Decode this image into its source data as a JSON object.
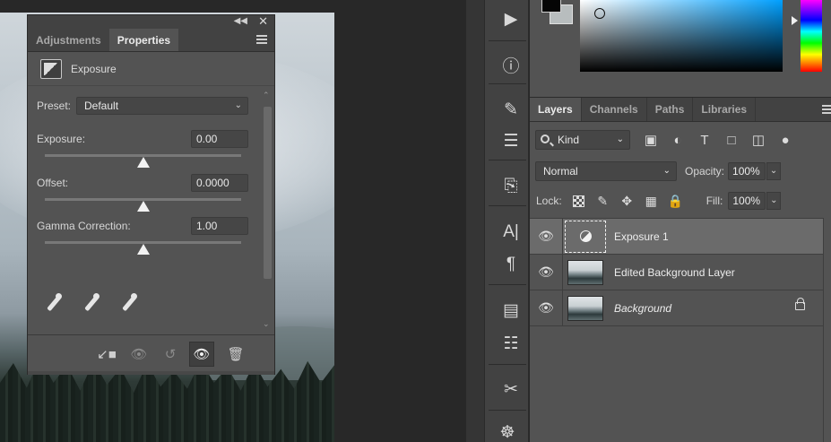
{
  "properties_panel": {
    "tabs": [
      {
        "label": "Adjustments",
        "active": false
      },
      {
        "label": "Properties",
        "active": true
      }
    ],
    "adjustment_title": "Exposure",
    "preset": {
      "label": "Preset:",
      "value": "Default"
    },
    "sliders": [
      {
        "label": "Exposure:",
        "value": "0.00",
        "position": 0.5
      },
      {
        "label": "Offset:",
        "value": "0.0000",
        "position": 0.5
      },
      {
        "label": "Gamma Correction:",
        "value": "1.00",
        "position": 0.5
      }
    ],
    "eyedroppers": [
      "black-point-dropper",
      "gray-point-dropper",
      "white-point-dropper"
    ],
    "footer_icons": [
      "clip-to-layer-icon",
      "view-previous-state-icon",
      "reset-icon",
      "toggle-visibility-icon",
      "delete-icon"
    ]
  },
  "tools_panel": {
    "icons": [
      "play-icon",
      "info-icon",
      "brush-settings-icon",
      "adjust-sliders-icon",
      "clone-source-icon",
      "character-icon",
      "paragraph-icon",
      "notes-icon",
      "glyphs-icon",
      "tool-presets-icon",
      "ship-wheel-icon"
    ]
  },
  "color_panel": {
    "foreground": "#050505",
    "background": "#b8bdbe"
  },
  "layers_panel": {
    "tabs": [
      {
        "label": "Layers",
        "active": true
      },
      {
        "label": "Channels",
        "active": false
      },
      {
        "label": "Paths",
        "active": false
      },
      {
        "label": "Libraries",
        "active": false
      }
    ],
    "filter_kind": "Kind",
    "blend_mode": "Normal",
    "opacity_label": "Opacity:",
    "opacity_value": "100%",
    "lock_label": "Lock:",
    "fill_label": "Fill:",
    "fill_value": "100%",
    "layers": [
      {
        "name": "Exposure 1",
        "type": "adjustment",
        "selected": true,
        "visible": true,
        "locked": false
      },
      {
        "name": "Edited Background Layer",
        "type": "photo",
        "selected": false,
        "visible": true,
        "locked": false
      },
      {
        "name": "Background",
        "type": "photo",
        "selected": false,
        "visible": true,
        "locked": true
      }
    ]
  }
}
